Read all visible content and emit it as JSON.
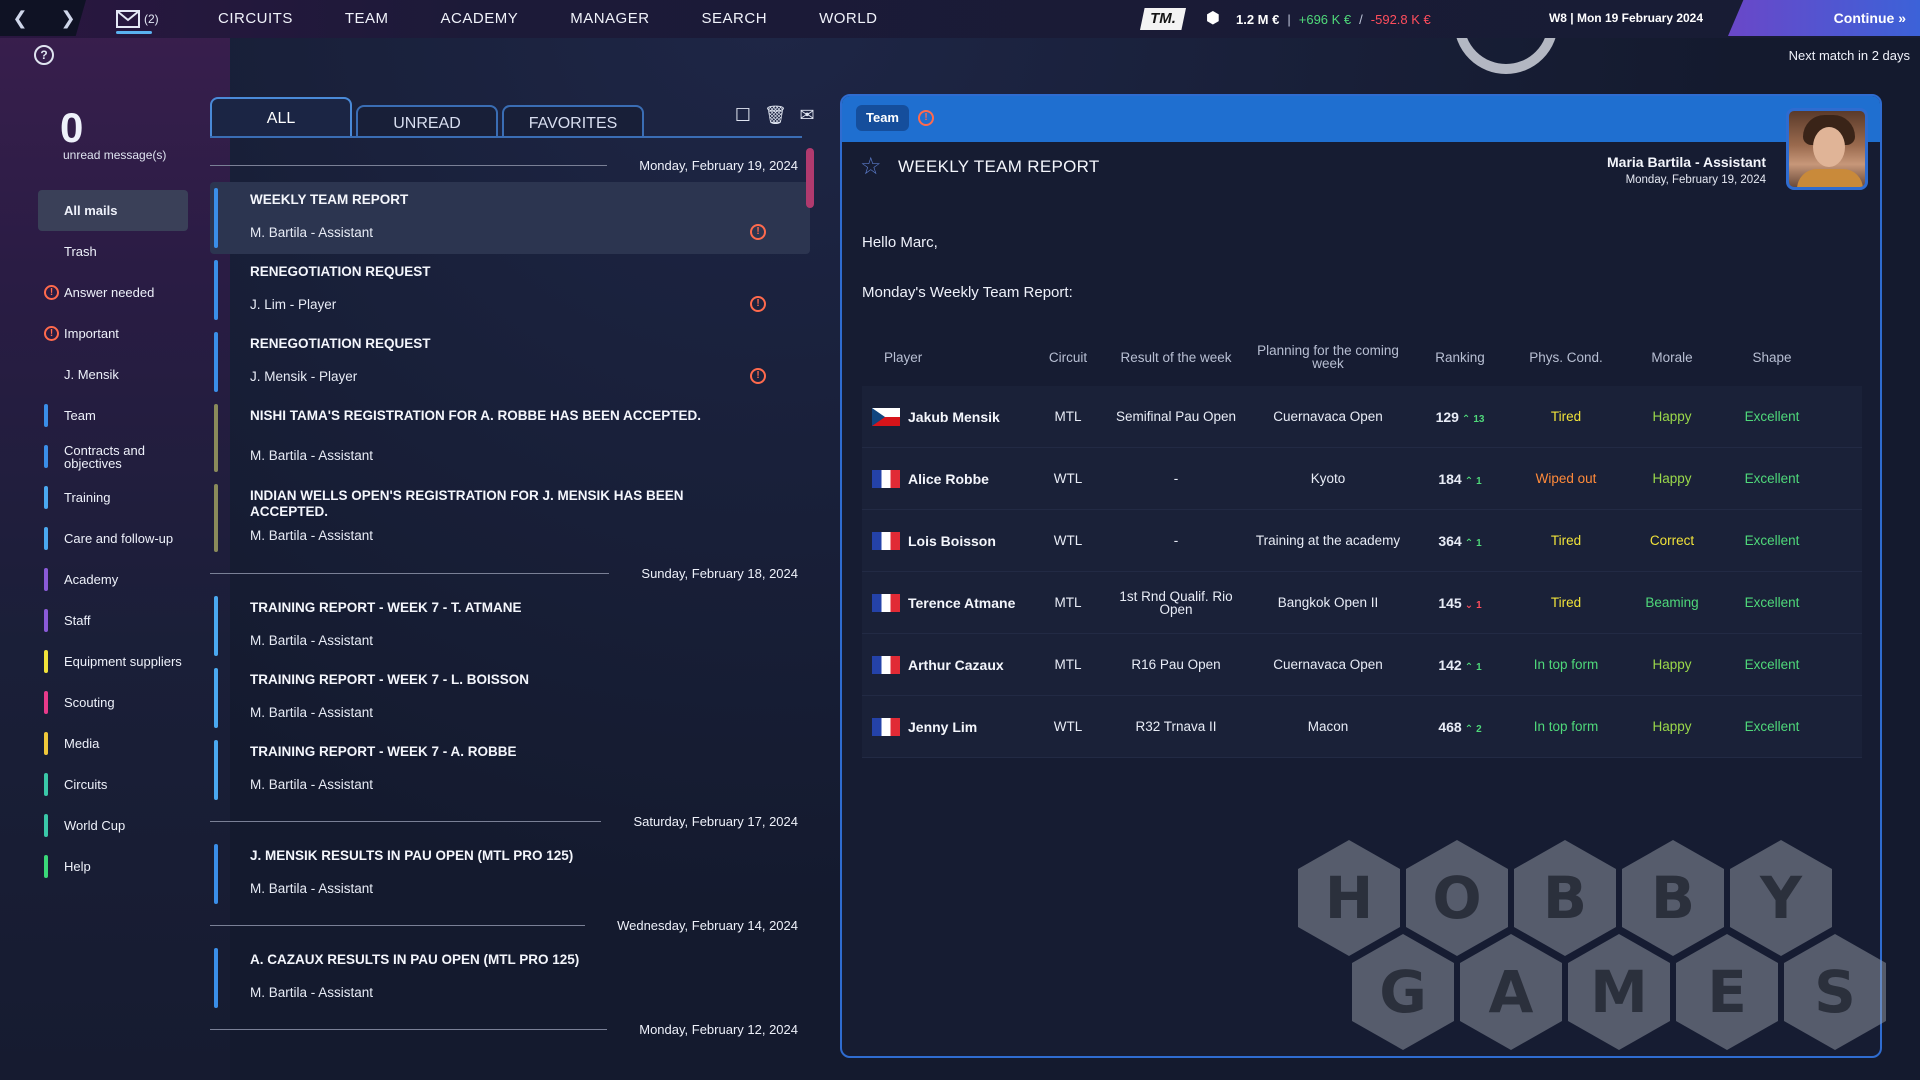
{
  "topbar": {
    "mail_count": "(2)",
    "nav": [
      "CIRCUITS",
      "TEAM",
      "ACADEMY",
      "MANAGER",
      "SEARCH",
      "WORLD"
    ],
    "logo": "TM.",
    "balance": "1.2 M €",
    "income": "+696 K €",
    "expense": "-592.8 K €",
    "date": "W8 | Mon 19 February 2024",
    "continue": "Continue",
    "next_match": "Next match in 2 days"
  },
  "sidebar": {
    "unread_count": "0",
    "unread_label": "unread message(s)",
    "items": [
      {
        "label": "All mails",
        "color": "",
        "warn": false,
        "active": true
      },
      {
        "label": "Trash",
        "color": "",
        "warn": false,
        "active": false
      },
      {
        "label": "Answer needed",
        "color": "",
        "warn": true,
        "active": false
      },
      {
        "label": "Important",
        "color": "",
        "warn": true,
        "active": false
      },
      {
        "label": "J. Mensik",
        "color": "",
        "warn": false,
        "active": false
      },
      {
        "label": "Team",
        "color": "#3a8ee8",
        "warn": false,
        "active": false
      },
      {
        "label": "Contracts and objectives",
        "color": "#3a8ee8",
        "warn": false,
        "active": false
      },
      {
        "label": "Training",
        "color": "#4aa8f0",
        "warn": false,
        "active": false
      },
      {
        "label": "Care and follow-up",
        "color": "#4aa8f0",
        "warn": false,
        "active": false
      },
      {
        "label": "Academy",
        "color": "#8a5ad8",
        "warn": false,
        "active": false
      },
      {
        "label": "Staff",
        "color": "#8a5ad8",
        "warn": false,
        "active": false
      },
      {
        "label": "Equipment suppliers",
        "color": "#f0e23a",
        "warn": false,
        "active": false
      },
      {
        "label": "Scouting",
        "color": "#e83a8a",
        "warn": false,
        "active": false
      },
      {
        "label": "Media",
        "color": "#f0c83a",
        "warn": false,
        "active": false
      },
      {
        "label": "Circuits",
        "color": "#3ac8a8",
        "warn": false,
        "active": false
      },
      {
        "label": "World Cup",
        "color": "#3ac8a8",
        "warn": false,
        "active": false
      },
      {
        "label": "Help",
        "color": "#3ad878",
        "warn": false,
        "active": false
      }
    ]
  },
  "tabs": [
    "ALL",
    "UNREAD",
    "FAVORITES"
  ],
  "mail_groups": [
    {
      "date": "Monday, February 19, 2024",
      "mails": [
        {
          "subject": "WEEKLY TEAM REPORT",
          "sender": "M. Bartila - Assistant",
          "warn": true,
          "color": "#3a8ee8",
          "selected": true
        },
        {
          "subject": "RENEGOTIATION REQUEST",
          "sender": "J. Lim - Player",
          "warn": true,
          "color": "#3a8ee8",
          "selected": false
        },
        {
          "subject": "RENEGOTIATION REQUEST",
          "sender": "J. Mensik - Player",
          "warn": true,
          "color": "#3a8ee8",
          "selected": false
        },
        {
          "subject": "NISHI TAMA'S REGISTRATION FOR A. ROBBE HAS BEEN ACCEPTED.",
          "sender": "M. Bartila - Assistant",
          "warn": false,
          "color": "#8a8a5a",
          "selected": false
        },
        {
          "subject": "INDIAN WELLS OPEN'S REGISTRATION FOR J. MENSIK HAS BEEN ACCEPTED.",
          "sender": "M. Bartila - Assistant",
          "warn": false,
          "color": "#8a8a5a",
          "selected": false
        }
      ]
    },
    {
      "date": "Sunday, February 18, 2024",
      "mails": [
        {
          "subject": "TRAINING REPORT - WEEK 7 - T. ATMANE",
          "sender": "M. Bartila - Assistant",
          "warn": false,
          "color": "#4aa8f0",
          "selected": false
        },
        {
          "subject": "TRAINING REPORT - WEEK 7 - L. BOISSON",
          "sender": "M. Bartila - Assistant",
          "warn": false,
          "color": "#4aa8f0",
          "selected": false
        },
        {
          "subject": "TRAINING REPORT - WEEK 7 - A. ROBBE",
          "sender": "M. Bartila - Assistant",
          "warn": false,
          "color": "#4aa8f0",
          "selected": false
        }
      ]
    },
    {
      "date": "Saturday, February 17, 2024",
      "mails": [
        {
          "subject": "J. MENSIK RESULTS IN PAU OPEN (MTL PRO 125)",
          "sender": "M. Bartila - Assistant",
          "warn": false,
          "color": "#3a8ee8",
          "selected": false
        }
      ]
    },
    {
      "date": "Wednesday, February 14, 2024",
      "mails": [
        {
          "subject": "A. CAZAUX RESULTS IN PAU OPEN (MTL PRO 125)",
          "sender": "M. Bartila - Assistant",
          "warn": false,
          "color": "#3a8ee8",
          "selected": false
        }
      ]
    },
    {
      "date": "Monday, February 12, 2024",
      "mails": []
    }
  ],
  "detail": {
    "category": "Team",
    "title": "WEEKLY TEAM REPORT",
    "from_name": "Maria Bartila - Assistant",
    "from_date": "Monday, February 19, 2024",
    "greeting": "Hello Marc,",
    "intro": "Monday's Weekly Team Report:",
    "columns": [
      "Player",
      "Circuit",
      "Result of the week",
      "Planning for the coming week",
      "Ranking",
      "Phys. Cond.",
      "Morale",
      "Shape"
    ],
    "rows": [
      {
        "flag": "cz",
        "player": "Jakub Mensik",
        "circuit": "MTL",
        "result": "Semifinal Pau Open",
        "planning": "Cuernavaca Open",
        "ranking": "129",
        "delta": "13",
        "dir": "up",
        "phys": "Tired",
        "phys_color": "#f0e23a",
        "morale": "Happy",
        "morale_color": "#9ad84a",
        "shape": "Excellent",
        "shape_color": "#4fd87a"
      },
      {
        "flag": "fr",
        "player": "Alice Robbe",
        "circuit": "WTL",
        "result": "-",
        "planning": "Kyoto",
        "ranking": "184",
        "delta": "1",
        "dir": "up",
        "phys": "Wiped out",
        "phys_color": "#ff8a3a",
        "morale": "Happy",
        "morale_color": "#9ad84a",
        "shape": "Excellent",
        "shape_color": "#4fd87a"
      },
      {
        "flag": "fr",
        "player": "Lois Boisson",
        "circuit": "WTL",
        "result": "-",
        "planning": "Training at the academy",
        "ranking": "364",
        "delta": "1",
        "dir": "up",
        "phys": "Tired",
        "phys_color": "#f0e23a",
        "morale": "Correct",
        "morale_color": "#f0e23a",
        "shape": "Excellent",
        "shape_color": "#4fd87a"
      },
      {
        "flag": "fr",
        "player": "Terence Atmane",
        "circuit": "MTL",
        "result": "1st Rnd Qualif. Rio Open",
        "planning": "Bangkok Open II",
        "ranking": "145",
        "delta": "1",
        "dir": "down",
        "phys": "Tired",
        "phys_color": "#f0e23a",
        "morale": "Beaming",
        "morale_color": "#4fd87a",
        "shape": "Excellent",
        "shape_color": "#4fd87a"
      },
      {
        "flag": "fr",
        "player": "Arthur Cazaux",
        "circuit": "MTL",
        "result": "R16 Pau Open",
        "planning": "Cuernavaca Open",
        "ranking": "142",
        "delta": "1",
        "dir": "up",
        "phys": "In top form",
        "phys_color": "#4fd87a",
        "morale": "Happy",
        "morale_color": "#9ad84a",
        "shape": "Excellent",
        "shape_color": "#4fd87a"
      },
      {
        "flag": "fr",
        "player": "Jenny Lim",
        "circuit": "WTL",
        "result": "R32 Trnava II",
        "planning": "Macon",
        "ranking": "468",
        "delta": "2",
        "dir": "up",
        "phys": "In top form",
        "phys_color": "#4fd87a",
        "morale": "Happy",
        "morale_color": "#9ad84a",
        "shape": "Excellent",
        "shape_color": "#4fd87a"
      }
    ]
  },
  "watermark": {
    "row1": [
      "H",
      "O",
      "B",
      "B",
      "Y"
    ],
    "row2": [
      "G",
      "A",
      "M",
      "E",
      "S"
    ]
  }
}
